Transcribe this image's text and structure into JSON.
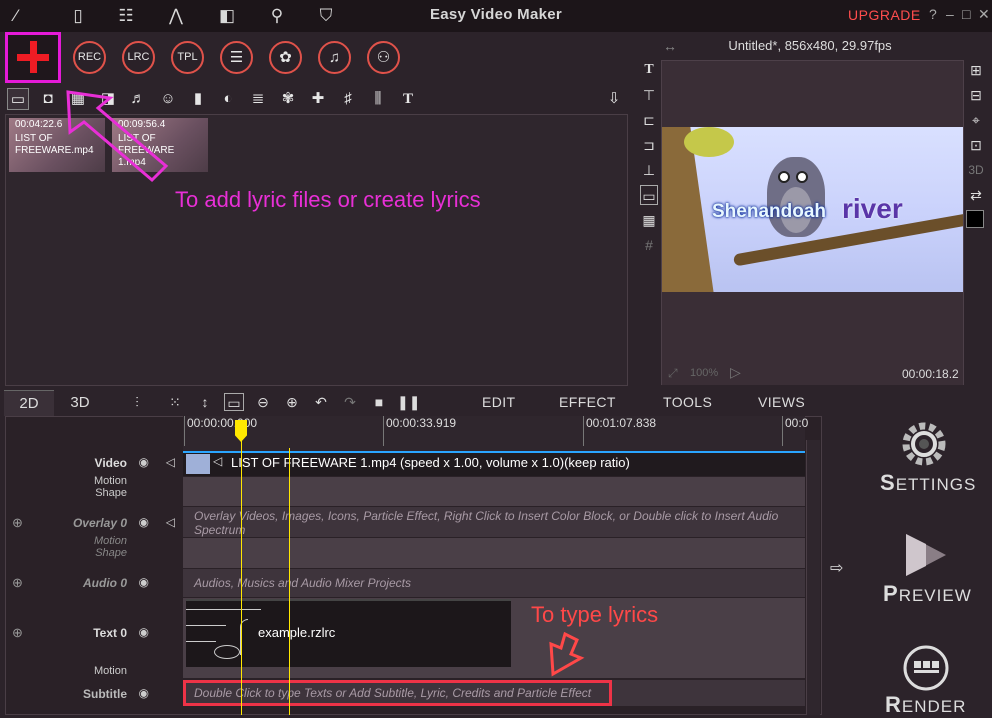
{
  "app": {
    "title": "Easy Video Maker",
    "upgrade": "UPGRADE",
    "help": "?",
    "minimize": "–",
    "maximize": "□",
    "close": "✕"
  },
  "circle_buttons": [
    {
      "name": "rec-button",
      "label": "REC"
    },
    {
      "name": "lrc-button",
      "label": "LRC"
    },
    {
      "name": "tpl-button",
      "label": "TPL"
    },
    {
      "name": "list-button",
      "label": "☰"
    },
    {
      "name": "effects-button",
      "label": "✿"
    },
    {
      "name": "lyrics-button",
      "label": "♫"
    },
    {
      "name": "user-button",
      "label": "⚇"
    }
  ],
  "media": [
    {
      "time": "00:04:22.6",
      "name": "LIST OF FREEWARE.mp4"
    },
    {
      "time": "00:09:56.4",
      "name": "LIST OF FREEWARE 1.mp4"
    }
  ],
  "annotations": {
    "top": "To add lyric files or create lyrics",
    "bottom": "To type lyrics"
  },
  "preview": {
    "title": "Untitled*, 856x480, 29.97fps",
    "lyric_part1": "Shenandoah",
    "lyric_part2": "river",
    "zoom": "100%",
    "time": "00:00:18.2"
  },
  "tabs": {
    "t2d": "2D",
    "t3d": "3D"
  },
  "menus": {
    "edit": "EDIT",
    "effect": "EFFECT",
    "tools": "TOOLS",
    "views": "VIEWS"
  },
  "ruler": [
    "00:00:00.000",
    "00:00:33.919",
    "00:01:07.838",
    "00:0"
  ],
  "tracks": {
    "video": {
      "label": "Video",
      "motion": "Motion",
      "shape": "Shape",
      "clip": "LIST OF FREEWARE 1.mp4  (speed x 1.00, volume x 1.0)(keep ratio)"
    },
    "overlay": {
      "label": "Overlay 0",
      "motion": "Motion",
      "shape": "Shape",
      "hint": "Overlay Videos, Images, Icons, Particle Effect, Right Click to Insert Color Block, or Double click to Insert Audio Spectrum"
    },
    "audio": {
      "label": "Audio 0",
      "hint": "Audios, Musics and Audio Mixer Projects"
    },
    "text": {
      "label": "Text 0",
      "motion": "Motion",
      "clip": "example.rzlrc"
    },
    "subtitle": {
      "label": "Subtitle",
      "hint": "Double Click to type Texts or Add Subtitle, Lyric, Credits and Particle Effect"
    }
  },
  "actions": {
    "settings_first": "S",
    "settings_rest": "ETTINGS",
    "preview_first": "P",
    "preview_rest": "REVIEW",
    "render_first": "R",
    "render_rest": "ENDER"
  },
  "colors": {
    "accent_magenta": "#e51ad8",
    "accent_red": "#ee3347",
    "playhead": "#ffe800"
  }
}
